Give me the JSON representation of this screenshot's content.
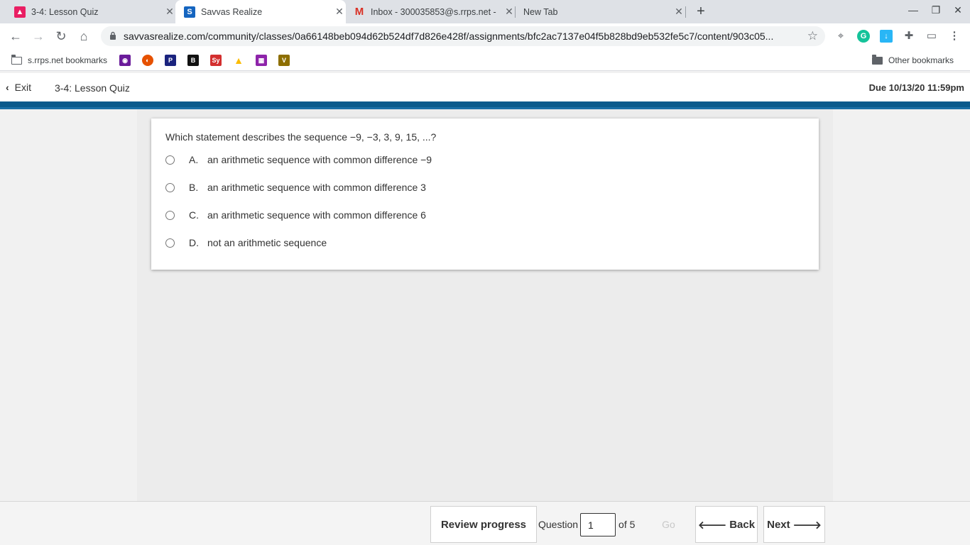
{
  "browser": {
    "tabs": [
      {
        "title": "3-4: Lesson Quiz",
        "icon": "classroom-icon",
        "color": "#e91e63"
      },
      {
        "title": "Savvas Realize",
        "icon": "savvas-icon",
        "color": "#1565c0"
      },
      {
        "title": "Inbox - 300035853@s.rrps.net - ",
        "icon": "gmail-icon",
        "color": "#d93025"
      },
      {
        "title": "New Tab",
        "icon": "",
        "color": ""
      }
    ],
    "url": "savvasrealize.com/community/classes/0a66148beb094d62b524df7d826e428f/assignments/bfc2ac7137e04f5b828bd9eb532fe5c7/content/903c05...",
    "bookmarks": {
      "folder_label": "s.rrps.net bookmarks",
      "other_label": "Other bookmarks",
      "icons": [
        {
          "name": "desmos-bookmark-icon",
          "glyph": "◉",
          "color": "#6a1b9a"
        },
        {
          "name": "firefox-bookmark-icon",
          "glyph": "◐",
          "color": "#e65100"
        },
        {
          "name": "pearson-bookmark-icon",
          "glyph": "P",
          "color": "#1a237e"
        },
        {
          "name": "b-bookmark-icon",
          "glyph": "B",
          "color": "#111111"
        },
        {
          "name": "sy-bookmark-icon",
          "glyph": "Sy",
          "color": "#d32f2f"
        },
        {
          "name": "drive-bookmark-icon",
          "glyph": "▲",
          "color": "#fbbc04"
        },
        {
          "name": "grid-bookmark-icon",
          "glyph": "▦",
          "color": "#8e24aa"
        },
        {
          "name": "v-bookmark-icon",
          "glyph": "V",
          "color": "#8d6e00"
        }
      ]
    }
  },
  "header": {
    "exit_label": "Exit",
    "quiz_title": "3-4: Lesson Quiz",
    "due": "Due 10/13/20 11:59pm"
  },
  "question": {
    "prompt": "Which statement describes the sequence −9, −3, 3, 9, 15, ...?",
    "options": [
      {
        "letter": "A.",
        "text": "an arithmetic sequence with common difference −9"
      },
      {
        "letter": "B.",
        "text": "an arithmetic sequence with common difference 3"
      },
      {
        "letter": "C.",
        "text": "an arithmetic sequence with common difference 6"
      },
      {
        "letter": "D.",
        "text": "not an arithmetic sequence"
      }
    ]
  },
  "footer": {
    "review_label": "Review progress",
    "question_label": "Question",
    "question_value": "1",
    "of_label": "of 5",
    "go_label": "Go",
    "back_label": "Back",
    "next_label": "Next"
  },
  "colors": {
    "accent_band": "#0a5a8c",
    "tabstrip": "#dee1e6"
  }
}
